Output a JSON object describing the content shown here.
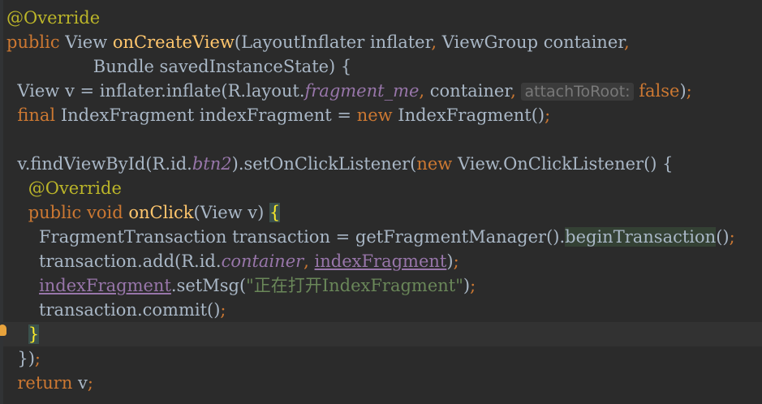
{
  "editor": {
    "lines": [
      {
        "parts": [
          {
            "t": "@Override",
            "c": "ann"
          }
        ]
      },
      {
        "parts": [
          {
            "t": "public ",
            "c": "kw"
          },
          {
            "t": "View "
          },
          {
            "t": "onCreateView",
            "c": "fn"
          },
          {
            "t": "(LayoutInflater inflater"
          },
          {
            "t": ", ",
            "c": "kw"
          },
          {
            "t": "ViewGroup container"
          },
          {
            "t": ",",
            "c": "kw"
          }
        ]
      },
      {
        "parts": [
          {
            "t": "                Bundle savedInstanceState) {"
          }
        ]
      },
      {
        "parts": [
          {
            "t": "  View v = inflater.inflate(R.layout."
          },
          {
            "t": "fragment_me",
            "c": "field-it"
          },
          {
            "t": ", ",
            "c": "kw"
          },
          {
            "t": "container"
          },
          {
            "t": ", ",
            "c": "kw"
          },
          {
            "t": "attachToRoot:",
            "c": "hint"
          },
          {
            "t": " "
          },
          {
            "t": "false",
            "c": "kw"
          },
          {
            "t": ")"
          },
          {
            "t": ";",
            "c": "kw"
          }
        ]
      },
      {
        "parts": [
          {
            "t": "  "
          },
          {
            "t": "final ",
            "c": "kw"
          },
          {
            "t": "IndexFragment indexFragment = "
          },
          {
            "t": "new ",
            "c": "kw"
          },
          {
            "t": "IndexFragment()"
          },
          {
            "t": ";",
            "c": "kw"
          }
        ]
      },
      {
        "parts": [
          {
            "t": ""
          }
        ]
      },
      {
        "parts": [
          {
            "t": "  v.findViewById(R.id."
          },
          {
            "t": "btn2",
            "c": "field-it"
          },
          {
            "t": ").setOnClickListener("
          },
          {
            "t": "new ",
            "c": "kw"
          },
          {
            "t": "View.OnClickListener() {"
          }
        ]
      },
      {
        "parts": [
          {
            "t": "    "
          },
          {
            "t": "@Override",
            "c": "ann"
          }
        ]
      },
      {
        "parts": [
          {
            "t": "    "
          },
          {
            "t": "public void ",
            "c": "kw"
          },
          {
            "t": "onClick",
            "c": "fn"
          },
          {
            "t": "(View v) "
          },
          {
            "t": "{",
            "c": "brace-match"
          }
        ]
      },
      {
        "parts": [
          {
            "t": "      FragmentTransaction transaction = getFragmentManager()."
          },
          {
            "t": "beginTransaction",
            "c": "hl"
          },
          {
            "t": "()"
          },
          {
            "t": ";",
            "c": "kw"
          }
        ]
      },
      {
        "parts": [
          {
            "t": "      transaction.add(R.id."
          },
          {
            "t": "container",
            "c": "field-it"
          },
          {
            "t": ", ",
            "c": "kw"
          },
          {
            "t": "indexFragment",
            "c": "field-ul"
          },
          {
            "t": ")"
          },
          {
            "t": ";",
            "c": "kw"
          }
        ]
      },
      {
        "parts": [
          {
            "t": "      "
          },
          {
            "t": "indexFragment",
            "c": "field-ul"
          },
          {
            "t": ".setMsg("
          },
          {
            "t": "\"正在打开IndexFragment\"",
            "c": "str"
          },
          {
            "t": ")"
          },
          {
            "t": ";",
            "c": "kw"
          }
        ]
      },
      {
        "parts": [
          {
            "t": "      transaction.commit()"
          },
          {
            "t": ";",
            "c": "kw"
          }
        ]
      },
      {
        "parts": [
          {
            "t": "    "
          },
          {
            "t": "}",
            "c": "brace-match"
          }
        ],
        "current": true
      },
      {
        "parts": [
          {
            "t": "  })"
          },
          {
            "t": ";",
            "c": "kw"
          }
        ]
      },
      {
        "parts": [
          {
            "t": "  "
          },
          {
            "t": "return ",
            "c": "kw"
          },
          {
            "t": "v"
          },
          {
            "t": ";",
            "c": "kw"
          }
        ]
      }
    ]
  },
  "colors": {
    "background": "#2b2b2b",
    "text": "#a9b7c6",
    "keyword": "#cc7832",
    "annotation": "#bbb529",
    "method": "#ffc66d",
    "field": "#9876aa",
    "string": "#6a8759"
  },
  "icons": {
    "gutter": "lightbulb-icon"
  }
}
